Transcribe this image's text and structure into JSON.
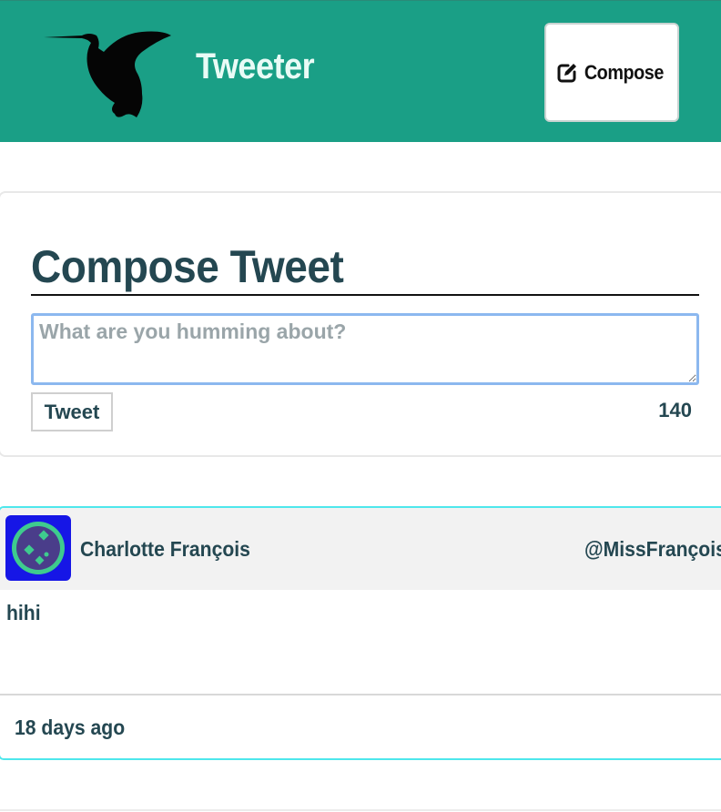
{
  "header": {
    "brand": "Tweeter",
    "logo_icon": "hummingbird-icon",
    "compose_icon": "edit-pencil-icon",
    "compose_label": "Compose",
    "background": "#1a9f86"
  },
  "compose": {
    "title": "Compose Tweet",
    "placeholder": "What are you humming about?",
    "value": "",
    "submit_label": "Tweet",
    "char_counter": "140"
  },
  "tweets": [
    {
      "avatar_icon": "robot-avatar-icon",
      "name": "Charlotte François",
      "handle": "@MissFrançois",
      "text": "hihi",
      "time": "18 days ago"
    }
  ],
  "colors": {
    "text": "#244751",
    "tweet_border": "#4ee7ec",
    "input_focus": "#8cb8ef"
  }
}
